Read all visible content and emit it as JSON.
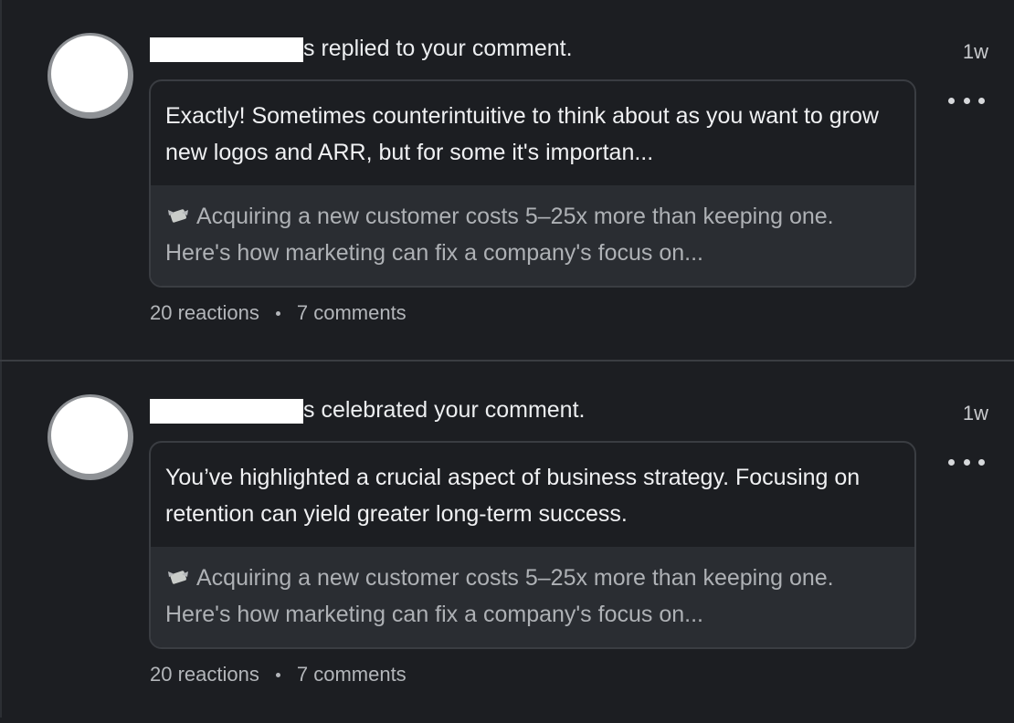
{
  "notifications": [
    {
      "action_text": "s replied to your comment.",
      "time": "1w",
      "comment": "Exactly! Sometimes counterintuitive to think about as you want to grow new logos and ARR, but for some it's importan...",
      "post_preview": "Acquiring a new customer costs 5–25x more than keeping one. Here's how marketing can fix a company's focus on...",
      "reactions": "20 reactions",
      "comments": "7 comments"
    },
    {
      "action_text": "s celebrated your comment.",
      "time": "1w",
      "comment": "You’ve highlighted a crucial aspect of business strategy. Focusing on retention can yield greater long-term success.",
      "post_preview": "Acquiring a new customer costs 5–25x more than keeping one. Here's how marketing can fix a company's focus on...",
      "reactions": "20 reactions",
      "comments": "7 comments"
    }
  ],
  "icons": {
    "more": "more-options-icon",
    "post": "money-wings-icon"
  },
  "colors": {
    "background": "#1c1e22",
    "card_border": "#3a3d42",
    "preview_background": "#2a2d32"
  }
}
